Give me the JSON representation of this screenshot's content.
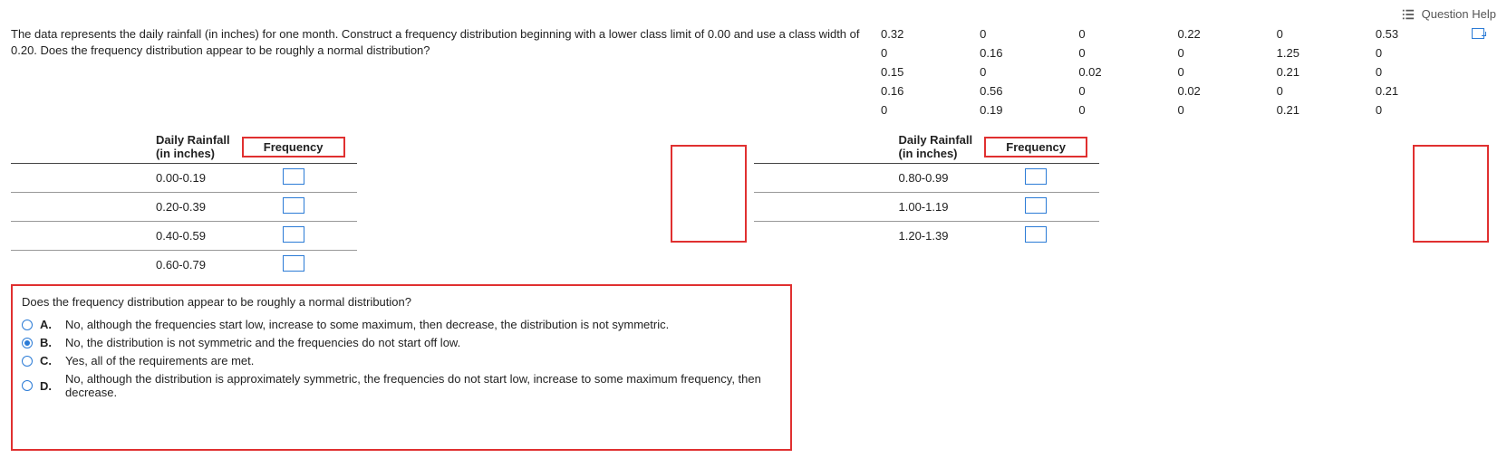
{
  "header": {
    "help_label": "Question Help"
  },
  "question": "The data represents the daily rainfall (in inches) for one month. Construct a frequency distribution beginning with a lower class limit of 0.00 and use a class width of 0.20. Does the frequency distribution appear to be roughly a normal distribution?",
  "data_values": [
    [
      "0.32",
      "0",
      "0",
      "0.22",
      "0",
      "0.53"
    ],
    [
      "0",
      "0.16",
      "0",
      "0",
      "1.25",
      "0"
    ],
    [
      "0.15",
      "0",
      "0.02",
      "0",
      "0.21",
      "0"
    ],
    [
      "0.16",
      "0.56",
      "0",
      "0.02",
      "0",
      "0.21"
    ],
    [
      "0",
      "0.19",
      "0",
      "0",
      "0.21",
      "0"
    ]
  ],
  "table_left": {
    "col1_header_l1": "Daily Rainfall",
    "col1_header_l2": "(in inches)",
    "col2_header": "Frequency",
    "rows": [
      "0.00-0.19",
      "0.20-0.39",
      "0.40-0.59",
      "0.60-0.79"
    ]
  },
  "table_right": {
    "col1_header_l1": "Daily Rainfall",
    "col1_header_l2": "(in inches)",
    "col2_header": "Frequency",
    "rows": [
      "0.80-0.99",
      "1.00-1.19",
      "1.20-1.39"
    ]
  },
  "mc": {
    "prompt": "Does the frequency distribution appear to be roughly a normal distribution?",
    "options": [
      {
        "letter": "A.",
        "text": "No, although the frequencies start low, increase to some maximum, then decrease, the distribution is not symmetric.",
        "selected": false
      },
      {
        "letter": "B.",
        "text": "No, the distribution is not symmetric and the frequencies do not start off low.",
        "selected": true
      },
      {
        "letter": "C.",
        "text": "Yes, all of the requirements are met.",
        "selected": false
      },
      {
        "letter": "D.",
        "text": "No, although the distribution is approximately symmetric, the frequencies do not start low, increase to some maximum frequency, then decrease.",
        "selected": false
      }
    ]
  }
}
